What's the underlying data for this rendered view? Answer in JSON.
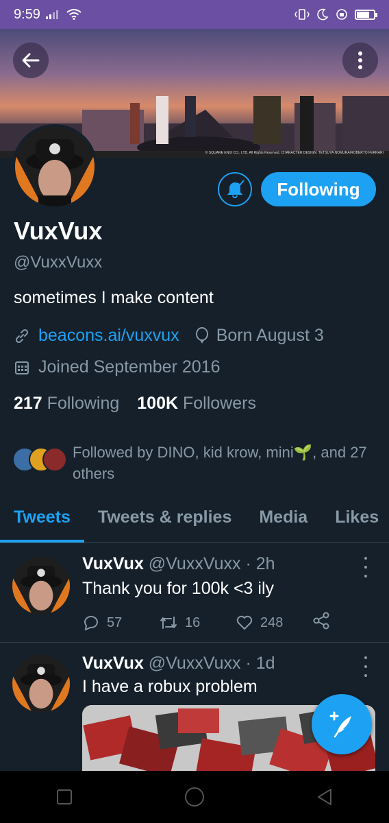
{
  "status_bar": {
    "time": "9:59"
  },
  "banner": {
    "credit": "© SQUARE ENIX CO., LTD. All Rights Reserved. CHARACTER DESIGN: TETSUYA NOMURA/ROBERTO FERRARI"
  },
  "profile": {
    "display_name": "VuxVux",
    "handle": "@VuxxVuxx",
    "bio": "sometimes I make content",
    "website": "beacons.ai/vuxvux",
    "birthday": "Born August 3",
    "joined": "Joined September 2016",
    "following_count": "217",
    "following_label": "Following",
    "followers_count": "100K",
    "followers_label": "Followers",
    "followed_by": "Followed by DINO, kid krow, mini🌱, and 27 others",
    "follow_button": "Following"
  },
  "tabs": [
    {
      "label": "Tweets"
    },
    {
      "label": "Tweets & replies"
    },
    {
      "label": "Media"
    },
    {
      "label": "Likes"
    }
  ],
  "tweets": [
    {
      "name": "VuxVux",
      "handle": "@VuxxVuxx",
      "time": "· 2h",
      "text": "Thank you for 100k <3 ily",
      "replies": "57",
      "retweets": "16",
      "likes": "248"
    },
    {
      "name": "VuxVux",
      "handle": "@VuxxVuxx",
      "time": "· 1d",
      "text": "I have a robux problem"
    }
  ],
  "colors": {
    "accent": "#1da1f2",
    "background": "#15202b",
    "muted": "#8899a6",
    "status_bar": "#6b4fa3"
  }
}
